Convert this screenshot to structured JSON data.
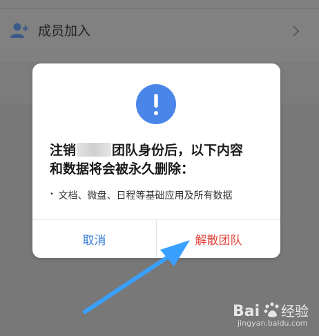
{
  "list": {
    "add_member_label": "成员加入"
  },
  "dialog": {
    "message_prefix": "注销",
    "message_suffix": "团队身份后，以下内容",
    "message_line2": "和数据将会被永久删除：",
    "detail": "文档、微盘、日程等基础应用及所有数据",
    "bullet": "•",
    "cancel_label": "取消",
    "confirm_label": "解散团队"
  },
  "colors": {
    "alert_blue": "#4a86e8",
    "cancel_blue": "#3b7fd9",
    "confirm_red": "#e0463d",
    "arrow_blue": "#3aa0ff"
  },
  "icons": {
    "add_member": "add-member-icon",
    "chevron": "chevron-right-icon",
    "alert": "exclamation-icon"
  },
  "watermark": {
    "brand": "Baidu经验",
    "url": "jingyan.baidu.com"
  }
}
